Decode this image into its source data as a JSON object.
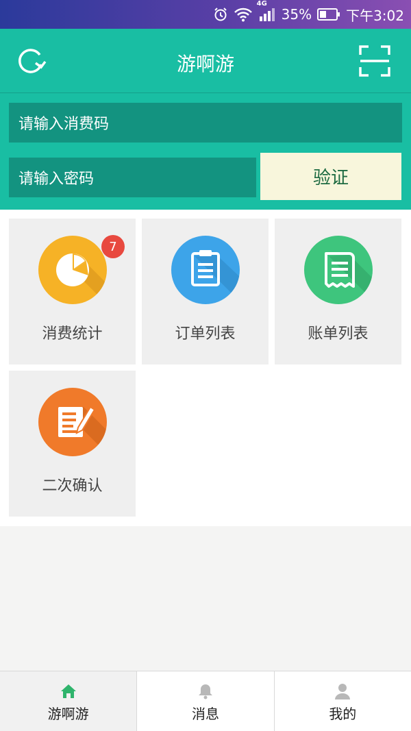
{
  "status_bar": {
    "network": "4G",
    "battery": "35%",
    "time": "下午3:02"
  },
  "header": {
    "title": "游啊游",
    "left_icon": "refresh-icon",
    "right_icon": "scan-icon"
  },
  "form": {
    "code_placeholder": "请输入消费码",
    "password_placeholder": "请输入密码",
    "verify_label": "验证"
  },
  "menu": {
    "items": [
      {
        "label": "消费统计",
        "icon": "pie-chart-icon",
        "color": "#f6b226",
        "badge": "7"
      },
      {
        "label": "订单列表",
        "icon": "clipboard-icon",
        "color": "#3da4e9"
      },
      {
        "label": "账单列表",
        "icon": "receipt-icon",
        "color": "#3ec57d"
      },
      {
        "label": "二次确认",
        "icon": "edit-document-icon",
        "color": "#f07a2a"
      }
    ]
  },
  "tabbar": {
    "items": [
      {
        "label": "游啊游",
        "icon": "home-icon",
        "active": true
      },
      {
        "label": "消息",
        "icon": "bell-icon"
      },
      {
        "label": "我的",
        "icon": "user-icon"
      }
    ]
  }
}
